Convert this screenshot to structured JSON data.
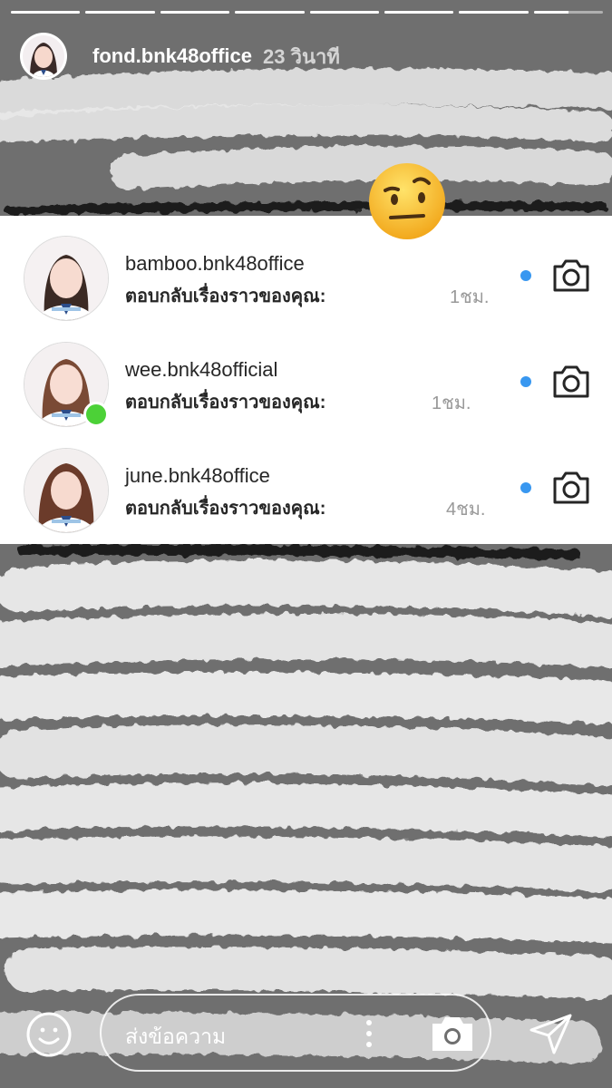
{
  "story": {
    "username": "fond.bnk48office",
    "time_ago": "23 วินาที",
    "progress": {
      "segments": 8,
      "completed": 7,
      "current_fraction": 0.5
    }
  },
  "replies": [
    {
      "username": "bamboo.bnk48office",
      "subtitle": "ตอบกลับเรื่องราวของคุณ:",
      "time": "1ชม.",
      "online": false,
      "unread": true
    },
    {
      "username": "wee.bnk48official",
      "subtitle": "ตอบกลับเรื่องราวของคุณ:",
      "time": "1ชม.",
      "online": true,
      "unread": true
    },
    {
      "username": "june.bnk48office",
      "subtitle": "ตอบกลับเรื่องราวของคุณ:",
      "time": "4ชม.",
      "online": false,
      "unread": true
    }
  ],
  "message_bar": {
    "placeholder": "ส่งข้อความ"
  },
  "colors": {
    "unread_dot": "#3897f0",
    "online_dot": "#4cd137",
    "background": "#6f6f6f"
  },
  "icons": [
    "emoji-face-icon",
    "more-vertical-icon",
    "camera-icon",
    "send-icon"
  ]
}
